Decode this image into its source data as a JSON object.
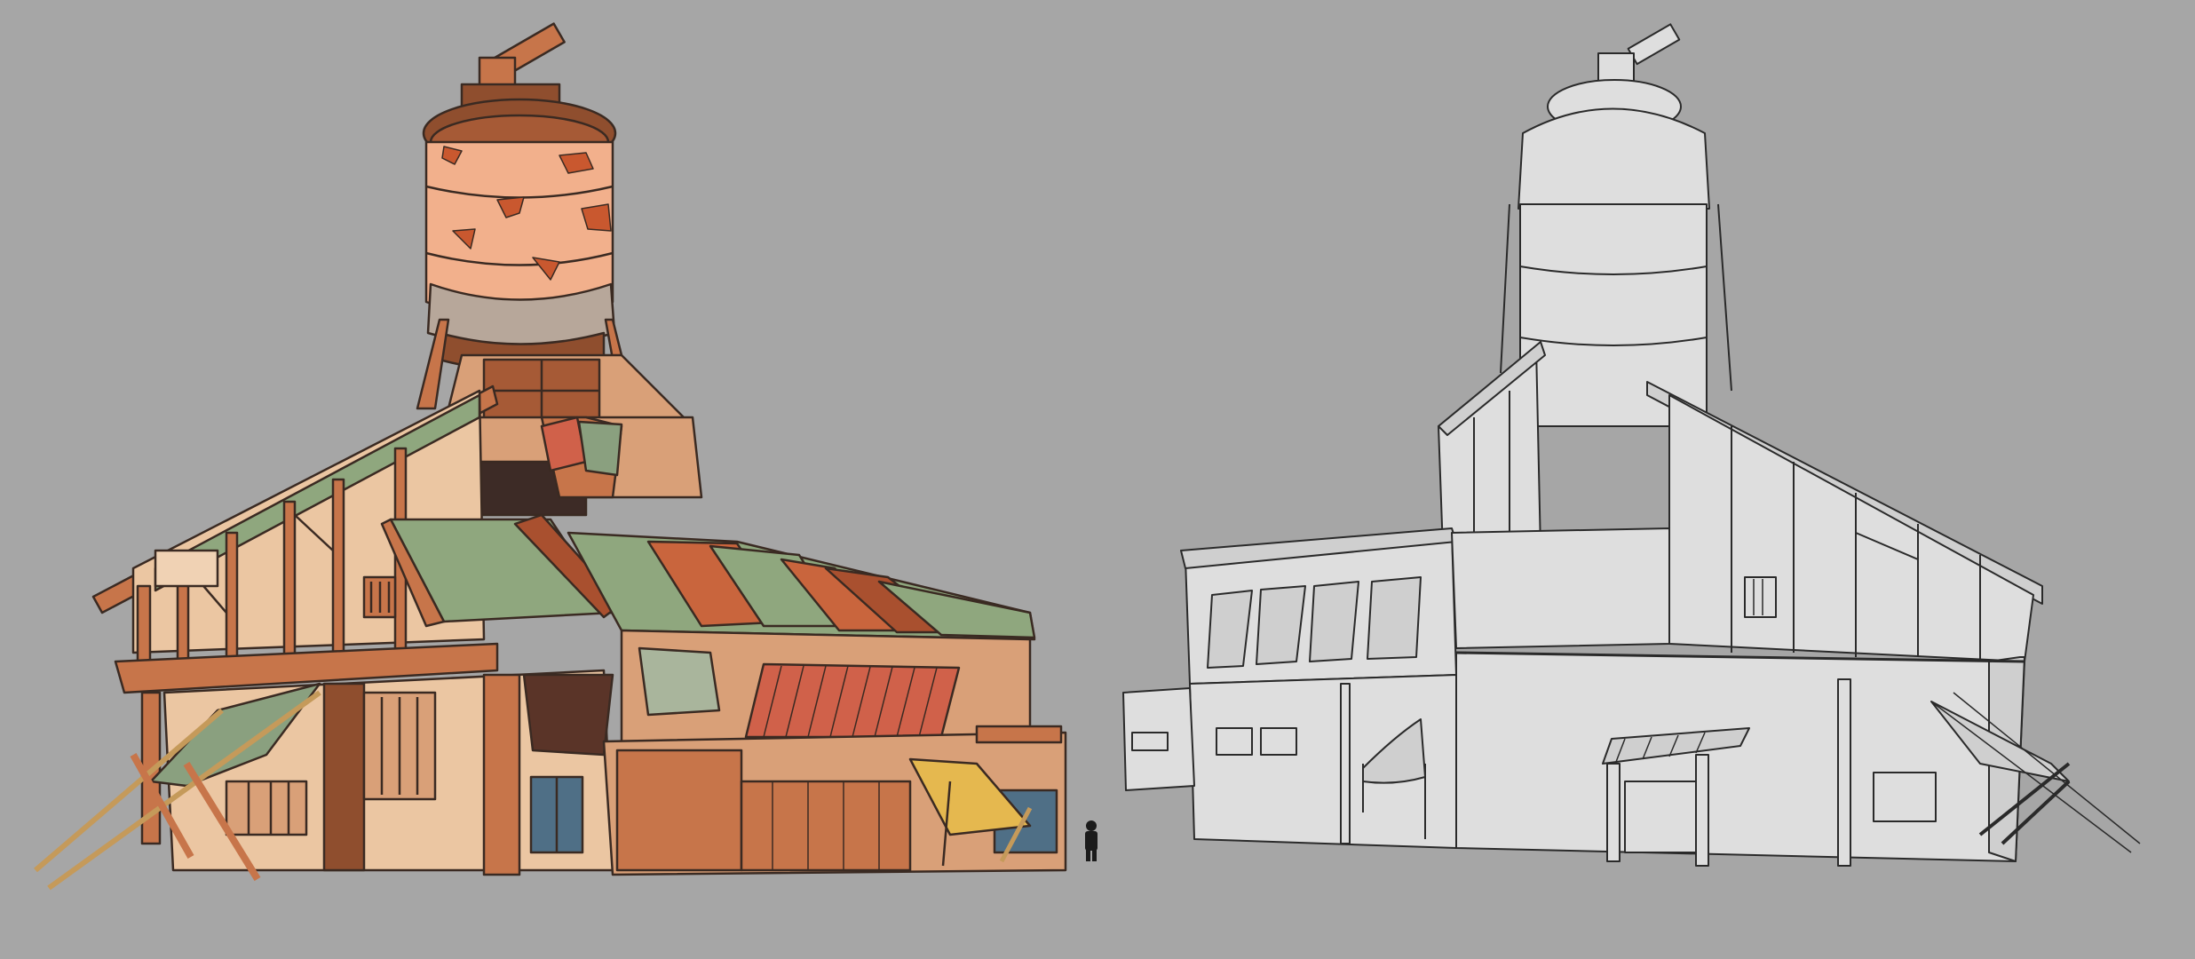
{
  "canvas": {
    "background": "#a6a6a6"
  },
  "artwork": {
    "colored_building": {
      "palette": {
        "outline": "#3a2a22",
        "tower_plaster": "#f2b08c",
        "tower_patch": "#c9582f",
        "tower_stone": "#b7a79a",
        "timber_dark": "#8f4e2e",
        "timber": "#c7754a",
        "wall_light": "#ebc6a2",
        "wall_mid": "#d9a078",
        "wall_cream": "#f0d2b4",
        "roof_green": "#8fa77e",
        "roof_red": "#c9653d",
        "roof_rust": "#a9502f",
        "awning_red": "#d0614a",
        "cloth_green": "#8aa07f",
        "cloth_yellow": "#e5b84f",
        "door_blue": "#4f6f86",
        "pole": "#c59a5a"
      }
    },
    "lineart_building": {
      "palette": {
        "outline": "#2a2a2a",
        "fill": "#dedede",
        "shade": "#cfcfcf"
      }
    },
    "scale_figure": {
      "color": "#1b1b1b"
    }
  }
}
